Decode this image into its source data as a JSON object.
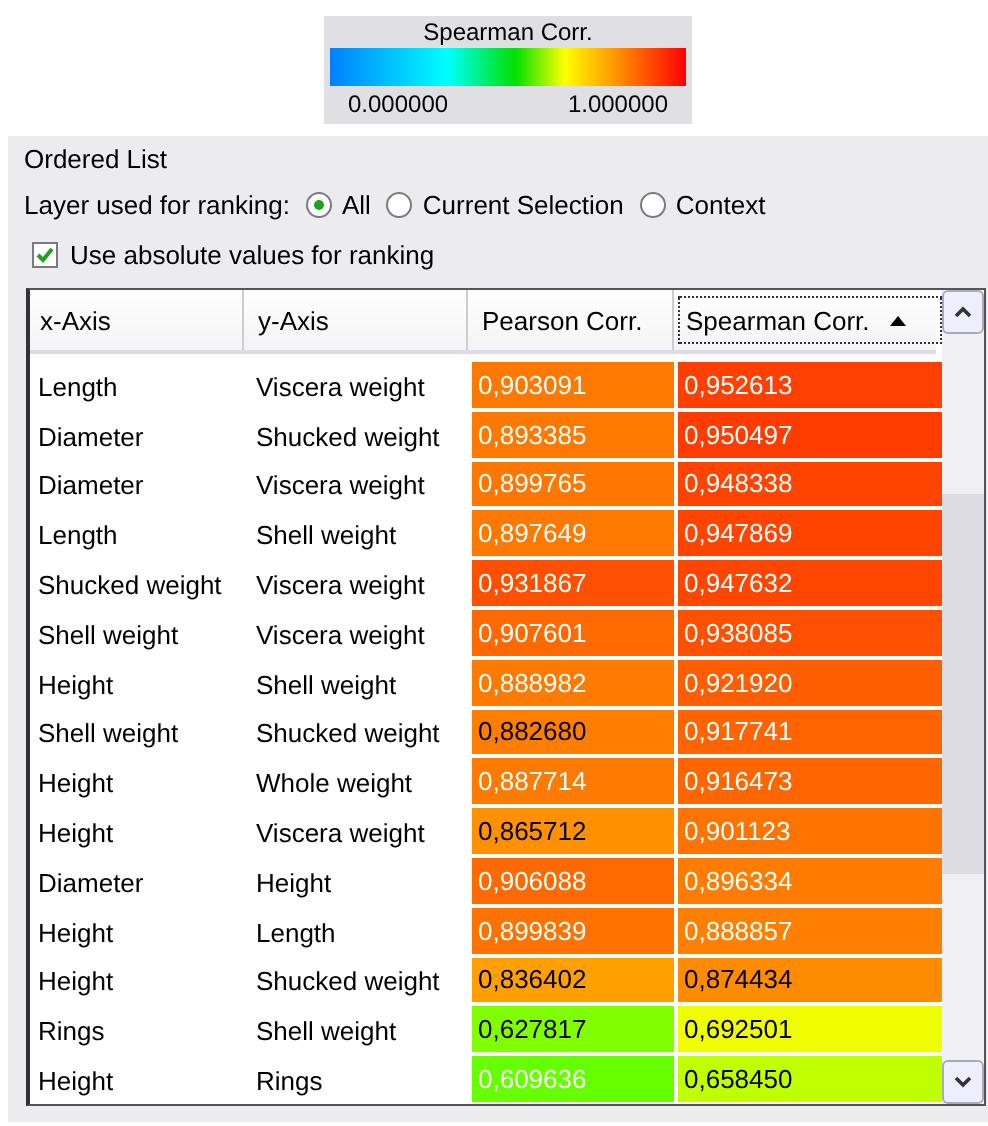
{
  "legend": {
    "title": "Spearman Corr.",
    "min_label": "0.000000",
    "max_label": "1.000000"
  },
  "panel": {
    "title": "Ordered List"
  },
  "ranking_layer": {
    "label": "Layer used for ranking:",
    "options": [
      {
        "label": "All",
        "selected": true
      },
      {
        "label": "Current Selection",
        "selected": false
      },
      {
        "label": "Context",
        "selected": false
      }
    ]
  },
  "absolute_values": {
    "label": "Use absolute values for ranking",
    "checked": true
  },
  "table": {
    "columns": [
      {
        "label": "x-Axis",
        "sorted": false
      },
      {
        "label": "y-Axis",
        "sorted": false
      },
      {
        "label": "Pearson Corr.",
        "sorted": false
      },
      {
        "label": "Spearman Corr.",
        "sorted": true
      }
    ],
    "rows": [
      {
        "x": "Length",
        "y": "Viscera weight",
        "pearson": {
          "value": "0,903091",
          "color": "#ff7800",
          "dark_text": false
        },
        "spearman": {
          "value": "0,952613",
          "color": "#ff4000",
          "dark_text": false
        }
      },
      {
        "x": "Diameter",
        "y": "Shucked weight",
        "pearson": {
          "value": "0,893385",
          "color": "#ff7800",
          "dark_text": false
        },
        "spearman": {
          "value": "0,950497",
          "color": "#ff3c00",
          "dark_text": false
        }
      },
      {
        "x": "Diameter",
        "y": "Viscera weight",
        "pearson": {
          "value": "0,899765",
          "color": "#ff7600",
          "dark_text": false
        },
        "spearman": {
          "value": "0,948338",
          "color": "#ff4400",
          "dark_text": false
        }
      },
      {
        "x": "Length",
        "y": "Shell weight",
        "pearson": {
          "value": "0,897649",
          "color": "#ff7800",
          "dark_text": false
        },
        "spearman": {
          "value": "0,947869",
          "color": "#ff4400",
          "dark_text": false
        }
      },
      {
        "x": "Shucked weight",
        "y": "Viscera weight",
        "pearson": {
          "value": "0,931867",
          "color": "#ff5000",
          "dark_text": false
        },
        "spearman": {
          "value": "0,947632",
          "color": "#ff4600",
          "dark_text": false
        }
      },
      {
        "x": "Shell weight",
        "y": "Viscera weight",
        "pearson": {
          "value": "0,907601",
          "color": "#ff6a00",
          "dark_text": false
        },
        "spearman": {
          "value": "0,938085",
          "color": "#ff5000",
          "dark_text": false
        }
      },
      {
        "x": "Height",
        "y": "Shell weight",
        "pearson": {
          "value": "0,888982",
          "color": "#ff7a00",
          "dark_text": false
        },
        "spearman": {
          "value": "0,921920",
          "color": "#ff5e00",
          "dark_text": false
        }
      },
      {
        "x": "Shell weight",
        "y": "Shucked weight",
        "pearson": {
          "value": "0,882680",
          "color": "#ff7e00",
          "dark_text": true
        },
        "spearman": {
          "value": "0,917741",
          "color": "#ff6400",
          "dark_text": false
        }
      },
      {
        "x": "Height",
        "y": "Whole weight",
        "pearson": {
          "value": "0,887714",
          "color": "#ff7a00",
          "dark_text": false
        },
        "spearman": {
          "value": "0,916473",
          "color": "#ff6600",
          "dark_text": false
        }
      },
      {
        "x": "Height",
        "y": "Viscera weight",
        "pearson": {
          "value": "0,865712",
          "color": "#ff9000",
          "dark_text": true
        },
        "spearman": {
          "value": "0,901123",
          "color": "#ff7400",
          "dark_text": false
        }
      },
      {
        "x": "Diameter",
        "y": "Height",
        "pearson": {
          "value": "0,906088",
          "color": "#ff6a00",
          "dark_text": false
        },
        "spearman": {
          "value": "0,896334",
          "color": "#ff7c00",
          "dark_text": false
        }
      },
      {
        "x": "Height",
        "y": "Length",
        "pearson": {
          "value": "0,899839",
          "color": "#ff7200",
          "dark_text": false
        },
        "spearman": {
          "value": "0,888857",
          "color": "#ff8000",
          "dark_text": false
        }
      },
      {
        "x": "Height",
        "y": "Shucked weight",
        "pearson": {
          "value": "0,836402",
          "color": "#ffa000",
          "dark_text": true
        },
        "spearman": {
          "value": "0,874434",
          "color": "#ff8c00",
          "dark_text": true
        }
      },
      {
        "x": "Rings",
        "y": "Shell weight",
        "pearson": {
          "value": "0,627817",
          "color": "#80ff00",
          "dark_text": true
        },
        "spearman": {
          "value": "0,692501",
          "color": "#f0ff00",
          "dark_text": true
        }
      },
      {
        "x": "Height",
        "y": "Rings",
        "pearson": {
          "value": "0,609636",
          "color": "#66ff00",
          "dark_text": false
        },
        "spearman": {
          "value": "0,658450",
          "color": "#c0ff00",
          "dark_text": true
        }
      }
    ]
  }
}
